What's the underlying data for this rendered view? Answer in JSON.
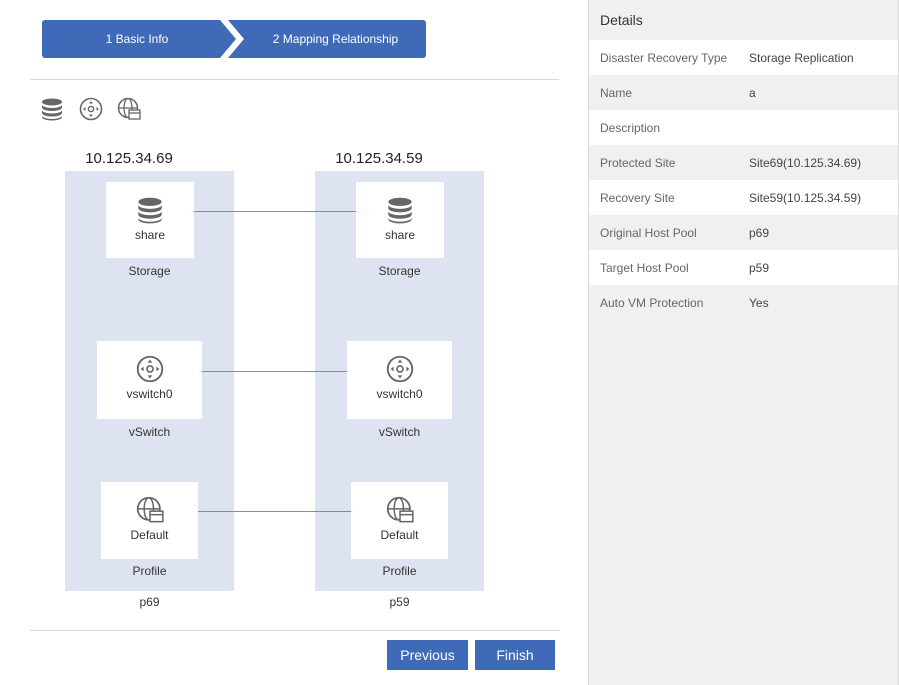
{
  "stepper": {
    "step1": "1 Basic Info",
    "step2": "2 Mapping Relationship"
  },
  "toolbar": {
    "icons": [
      "storage-icon",
      "vswitch-icon",
      "profile-icon"
    ]
  },
  "sites": {
    "source": {
      "ip": "10.125.34.69",
      "pool": "p69",
      "storage": {
        "name": "share",
        "category": "Storage"
      },
      "vswitch": {
        "name": "vswitch0",
        "category": "vSwitch"
      },
      "profile": {
        "name": "Default",
        "category": "Profile"
      }
    },
    "target": {
      "ip": "10.125.34.59",
      "pool": "p59",
      "storage": {
        "name": "share",
        "category": "Storage"
      },
      "vswitch": {
        "name": "vswitch0",
        "category": "vSwitch"
      },
      "profile": {
        "name": "Default",
        "category": "Profile"
      }
    }
  },
  "colors": {
    "accent": "#3f6ab8",
    "column_bg": "#dde3f1",
    "link": "#3cc43c"
  },
  "buttons": {
    "previous": "Previous",
    "finish": "Finish"
  },
  "details": {
    "title": "Details",
    "rows": [
      {
        "key": "Disaster Recovery Type",
        "value": "Storage Replication"
      },
      {
        "key": "Name",
        "value": "a"
      },
      {
        "key": "Description",
        "value": ""
      },
      {
        "key": "Protected Site",
        "value": "Site69(10.125.34.69)"
      },
      {
        "key": "Recovery Site",
        "value": "Site59(10.125.34.59)"
      },
      {
        "key": "Original Host Pool",
        "value": "p69"
      },
      {
        "key": "Target Host Pool",
        "value": "p59"
      },
      {
        "key": "Auto VM Protection",
        "value": "Yes"
      }
    ]
  }
}
